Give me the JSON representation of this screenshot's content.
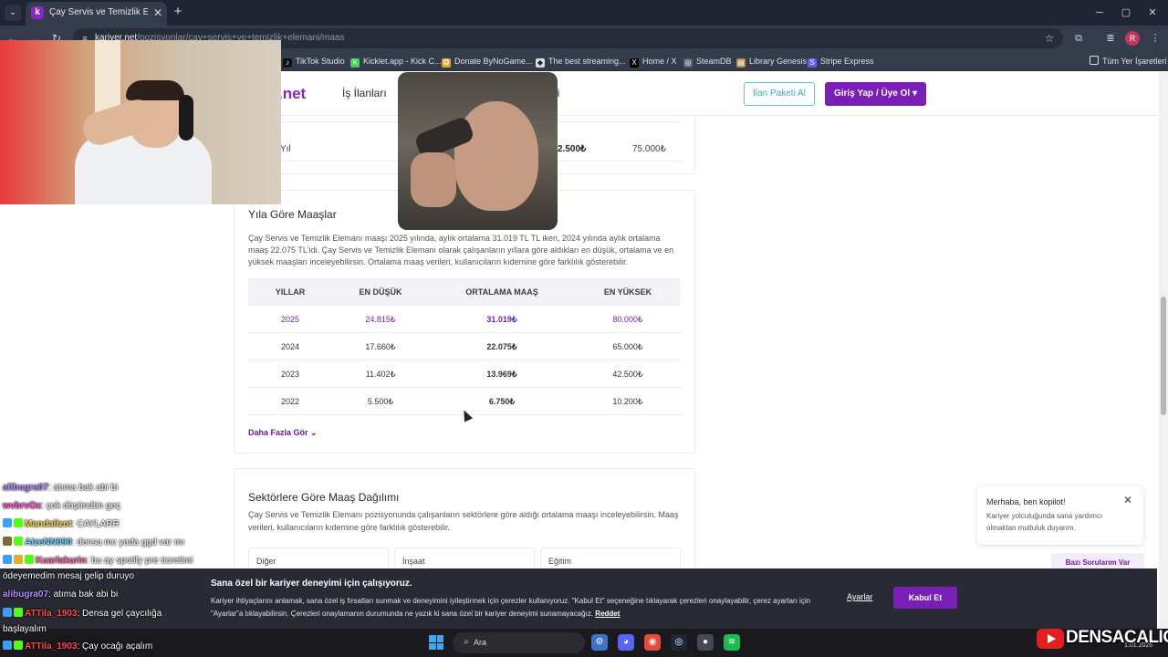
{
  "browser": {
    "tab_title": "Çay Servis ve Temizlik Elemanı Maaş",
    "url_host": "kariyer.net",
    "url_path": "/pozisyonlar/cay+servis+ve+temizlik+elemani/maas",
    "profile_initial": "R",
    "bookmarks": [
      "TikTok Studio",
      "Kicklet.app - Kick C...",
      "Donate ByNoGame...",
      "The best streaming...",
      "Home / X",
      "SteamDB",
      "Library Genesis",
      "Stripe Express"
    ],
    "all_bookmarks": "Tüm Yer İşaretleri"
  },
  "site": {
    "logo": ".net",
    "nav_jobs": "İş İlanları",
    "nav_other": "eri",
    "btn_post": "İlan Paketi Al",
    "btn_login": "Giriş Yap / Üye Ol"
  },
  "prev_row": {
    "year": "Yıl",
    "mid": "2.500₺",
    "max": "75.000₺"
  },
  "year_section": {
    "title": "Yıla Göre Maaşlar",
    "description": "Çay Servis ve Temizlik Elemanı maaşı 2025 yılında, aylık ortalama 31.019 TL TL iken, 2024 yılında aylık ortalama maaş 22.075 TL'idi. Çay Servis ve Temizlik Elemanı olarak çalışanların yıllara göre aldıkları en düşük, ortalama ve en yüksek maaşları inceleyebilirsin. Ortalama maaş verileri, kullanıcıların kıdemine göre farklılık gösterebilir.",
    "headers": [
      "YILLAR",
      "EN DÜŞÜK",
      "ORTALAMA MAAŞ",
      "EN YÜKSEK"
    ],
    "rows": [
      [
        "2025",
        "24.815₺",
        "31.019₺",
        "80.000₺"
      ],
      [
        "2024",
        "17.660₺",
        "22.075₺",
        "65.000₺"
      ],
      [
        "2023",
        "11.402₺",
        "13.969₺",
        "42.500₺"
      ],
      [
        "2022",
        "5.500₺",
        "6.750₺",
        "10.200₺"
      ]
    ],
    "more": "Daha Fazla Gör"
  },
  "sector_section": {
    "title": "Sektörlere Göre Maaş Dağılımı",
    "description": "Çay Servis ve Temizlik Elemanı pozisyonunda çalışanların sektörlere göre aldığı ortalama maaşı inceleyebilirsin. Maaş verileri, kullanıcıların kıdemine göre farklılık gösterebilir.",
    "sectors": [
      "Diğer",
      "İnşaat",
      "Eğitim"
    ]
  },
  "copilot": {
    "title": "Merhaba, ben kopilot!",
    "message": "Kariyer yolculuğunda sana yardımcı olmaktan mutluluk duyarım.",
    "questions_button": "Bazı Sorularım Var"
  },
  "cookie": {
    "title": "Sana özel bir kariyer deneyimi için çalışıyoruz.",
    "text": "Kariyer ihtiyaçlarını anlamak, sana özel iş fırsatları sunmak ve deneyimini iyileştirmek için çerezler kullanıyoruz. \"Kabul Et\" seçeneğine tıklayarak çerezleri onaylayabilir, çerez ayarları için \"Ayarlar\"a tıklayabilirsin. Çerezleri onaylamanın durumunda ne yazık ki sana özel bir kariyer deneyimi sunamayacağız.",
    "reject": "Reddet",
    "settings": "Ayarlar",
    "accept": "Kabul Et"
  },
  "taskbar": {
    "search": "Ara",
    "date": "1.01.2026"
  },
  "chat": [
    {
      "user": "alibugra07",
      "text": ": atıma bak abi bi"
    },
    {
      "user": "wvbrvOx",
      "text": ": çok düşündün geç"
    },
    {
      "user": "Mandalizot",
      "text": ": CAYLARR"
    },
    {
      "user": "AizeNN090",
      "text": ": densa mc yada ggd var mı"
    },
    {
      "user": "Kuarlakurin",
      "text": ": bu ay spotify pre ücretimi"
    },
    {
      "user": "",
      "text": "ödeyemedim mesaj gelip duruyo"
    },
    {
      "user": "alibugra07",
      "text": ": atıma bak abi bi"
    },
    {
      "user": "ATTila_1903",
      "text": ": Densa gel çaycılığa"
    },
    {
      "user": "",
      "text": "başlayalım"
    },
    {
      "user": "ATTila_1903",
      "text": ": Çay ocağı açalım"
    }
  ],
  "brand": "DENSACALIGO",
  "colors": {
    "brand_purple": "#7a1fb5",
    "accent_teal": "#3aaabb",
    "chrome_dark": "#343b4b"
  }
}
